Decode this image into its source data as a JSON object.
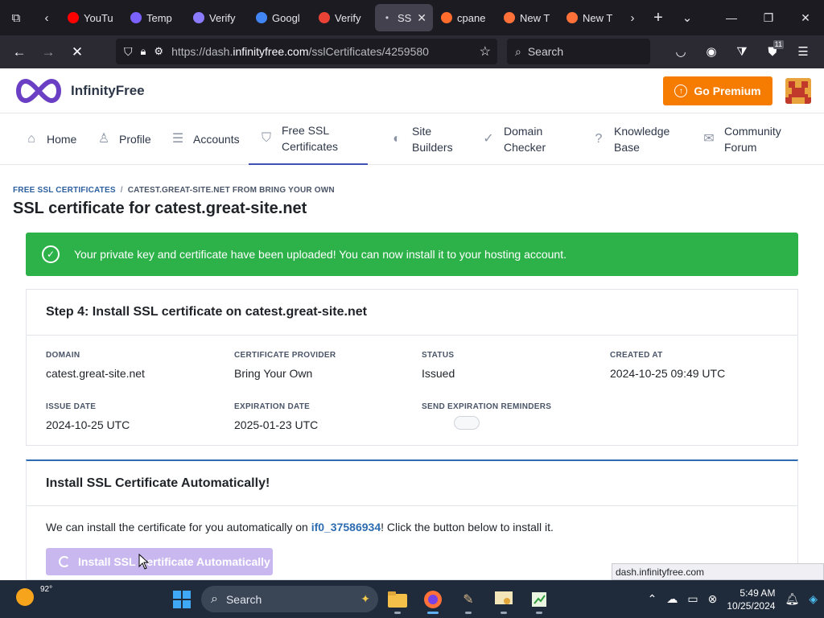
{
  "browser": {
    "tabs": [
      {
        "title": "YouTu",
        "icon": "youtube-icon",
        "color": "#ff0000"
      },
      {
        "title": "Temp",
        "icon": "temp-mail-icon",
        "color": "#7b61ff"
      },
      {
        "title": "Verify",
        "icon": "infinity-icon",
        "color": "#8b7bff"
      },
      {
        "title": "Googl",
        "icon": "google-icon",
        "color": "#4285f4"
      },
      {
        "title": "Verify",
        "icon": "gmail-icon",
        "color": "#ea4335"
      },
      {
        "title": "SSL",
        "icon": "loading-dot-icon",
        "color": "#cfcfd8"
      },
      {
        "title": "cpane",
        "icon": "cpanel-icon",
        "color": "#ff6c2c"
      },
      {
        "title": "New T",
        "icon": "firefox-icon",
        "color": "#ff7139"
      },
      {
        "title": "New T",
        "icon": "firefox-icon",
        "color": "#ff7139"
      }
    ],
    "url_prefix": "https://dash.",
    "url_domain": "infinityfree.com",
    "url_path": "/sslCertificates/4259580",
    "search_placeholder": "Search",
    "extension_badge": "11"
  },
  "site": {
    "logo_text": "InfinityFree",
    "premium_label": "Go Premium",
    "brand_color": "#f57c00",
    "menu": [
      {
        "label_line1": "Home",
        "label_line2": "",
        "icon": "home-icon"
      },
      {
        "label_line1": "Profile",
        "label_line2": "",
        "icon": "user-icon"
      },
      {
        "label_line1": "Accounts",
        "label_line2": "",
        "icon": "server-icon"
      },
      {
        "label_line1": "Free SSL",
        "label_line2": "Certificates",
        "icon": "shield-icon"
      },
      {
        "label_line1": "Site",
        "label_line2": "Builders",
        "icon": "palette-icon"
      },
      {
        "label_line1": "Domain",
        "label_line2": "Checker",
        "icon": "check-circle-icon"
      },
      {
        "label_line1": "Knowledge",
        "label_line2": "Base",
        "icon": "help-circle-icon"
      },
      {
        "label_line1": "Community",
        "label_line2": "Forum",
        "icon": "chat-icon"
      }
    ]
  },
  "page": {
    "breadcrumb_root": "FREE SSL CERTIFICATES",
    "breadcrumb_current": "CATEST.GREAT-SITE.NET FROM BRING YOUR OWN",
    "title": "SSL certificate for catest.great-site.net",
    "alert": "Your private key and certificate have been uploaded! You can now install it to your hosting account.",
    "alert_color": "#2db24a",
    "step_title": "Step 4: Install SSL certificate on catest.great-site.net",
    "fields": {
      "domain": {
        "label": "DOMAIN",
        "value": "catest.great-site.net"
      },
      "provider": {
        "label": "CERTIFICATE PROVIDER",
        "value": "Bring Your Own"
      },
      "status": {
        "label": "STATUS",
        "value": "Issued"
      },
      "created": {
        "label": "CREATED AT",
        "value": "2024-10-25 09:49 UTC"
      },
      "issue_date": {
        "label": "ISSUE DATE",
        "value": "2024-10-25 UTC"
      },
      "expiration": {
        "label": "EXPIRATION DATE",
        "value": "2025-01-23 UTC"
      },
      "reminders": {
        "label": "SEND EXPIRATION REMINDERS",
        "enabled": false
      }
    },
    "auto_title": "Install SSL Certificate Automatically!",
    "auto_text_before": "We can install the certificate for you automatically on ",
    "auto_account": "if0_37586934",
    "auto_text_after": "! Click the button below to install it.",
    "install_button": "Install SSL Certificate Automatically",
    "status_popup": "dash.infinityfree.com"
  },
  "taskbar": {
    "temperature": "92°",
    "search_placeholder": "Search",
    "time": "5:49 AM",
    "date": "10/25/2024"
  }
}
